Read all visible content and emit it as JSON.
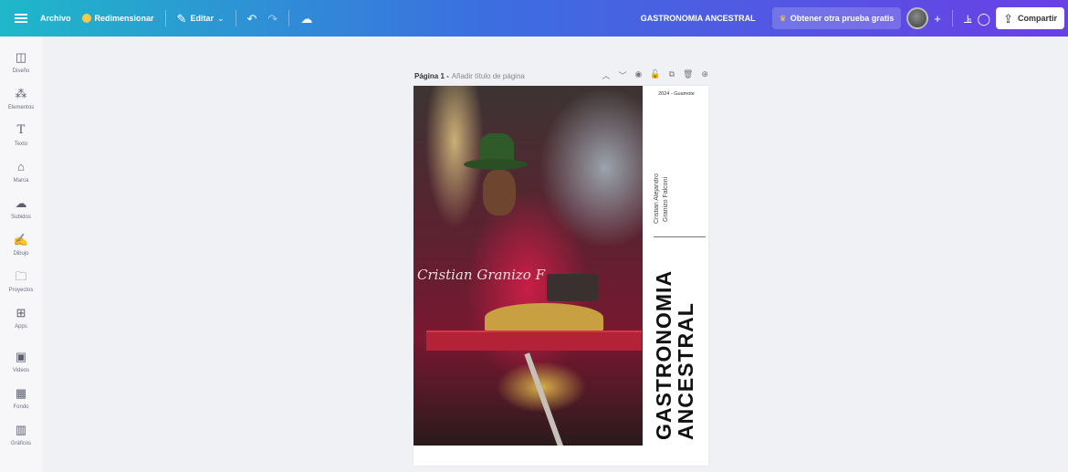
{
  "topbar": {
    "menu_icon": "hamburger-icon",
    "file_label": "Archivo",
    "resize_label": "Redimensionar",
    "edit_label": "Editar",
    "undo_icon": "undo-icon",
    "redo_icon": "redo-icon",
    "cloud_icon": "cloud-save-icon",
    "doc_title": "GASTRONOMIA ANCESTRAL",
    "trial_label": "Obtener otra prueba gratis",
    "share_label": "Compartir",
    "colors": {
      "gradient_start": "#1fb8c9",
      "gradient_mid": "#3b6fe0",
      "gradient_end": "#6a3fe6"
    }
  },
  "sidebar": {
    "items": [
      {
        "label": "Diseño",
        "icon": "layout-icon"
      },
      {
        "label": "Elementos",
        "icon": "elements-icon"
      },
      {
        "label": "Texto",
        "icon": "text-icon"
      },
      {
        "label": "Marca",
        "icon": "brand-icon"
      },
      {
        "label": "Subidos",
        "icon": "upload-icon"
      },
      {
        "label": "Dibujo",
        "icon": "draw-icon"
      },
      {
        "label": "Proyectos",
        "icon": "folder-icon"
      },
      {
        "label": "Apps",
        "icon": "apps-icon"
      },
      {
        "label": "Videos",
        "icon": "video-icon"
      },
      {
        "label": "Fondo",
        "icon": "background-icon"
      },
      {
        "label": "Gráficos",
        "icon": "chart-icon"
      }
    ]
  },
  "page_header": {
    "page_label": "Página 1 -",
    "title_placeholder": "Añadir título de página"
  },
  "design": {
    "year_location": "2024 - Guamote",
    "author_line1": "Cristian Alejandro",
    "author_line2": "Granizo Falconi",
    "title_line1": "GASTRONOMIA",
    "title_line2": "ANCESTRAL",
    "signature": "Cristian Granizo F"
  }
}
